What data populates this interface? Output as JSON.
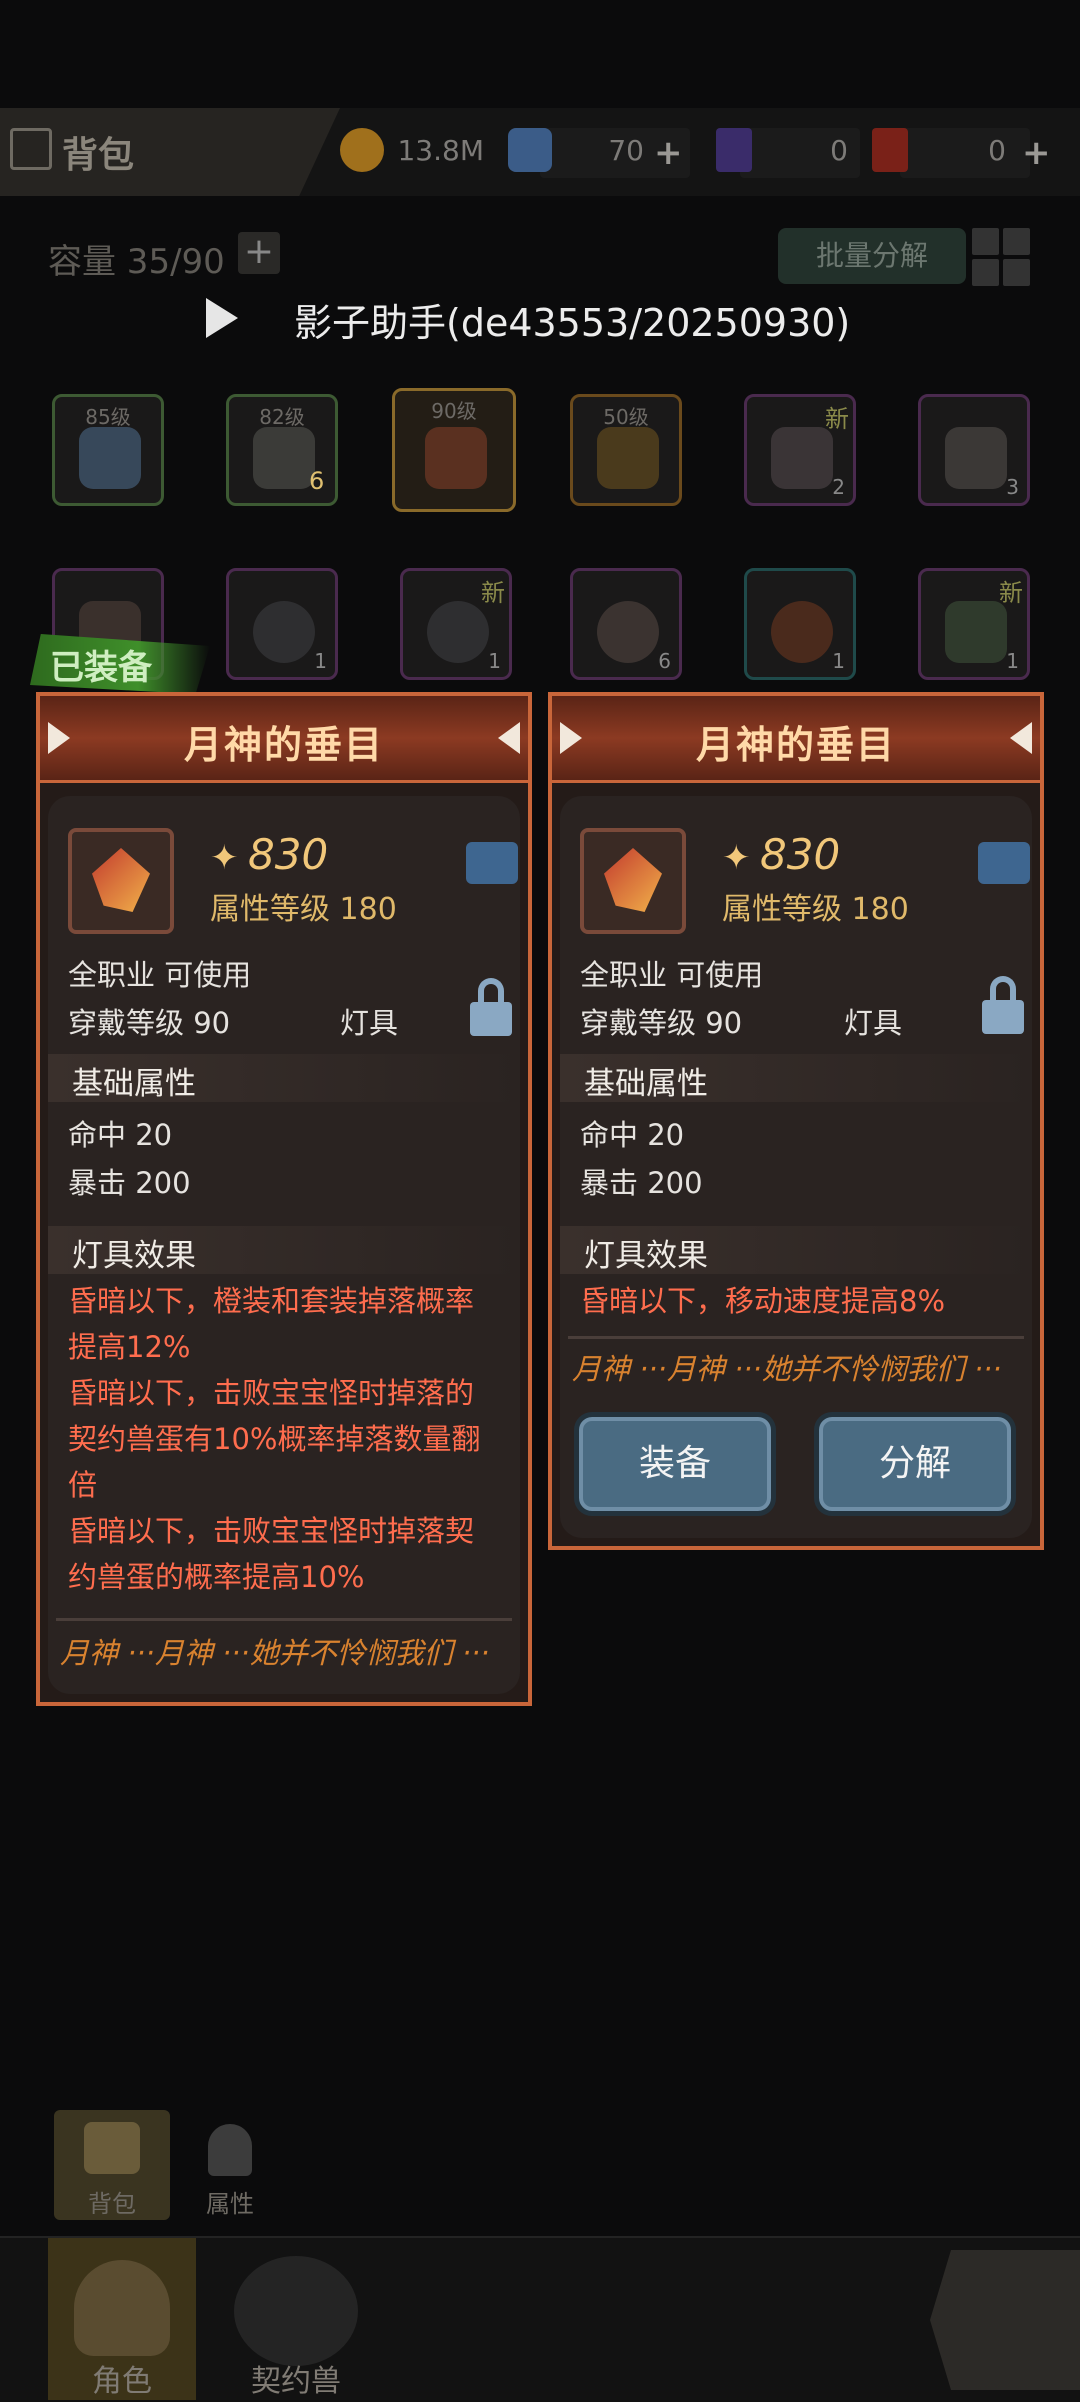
{
  "header": {
    "title": "背包",
    "gold": "13.8M",
    "crystal": "70",
    "ticket_purple": "0",
    "ticket_red": "0"
  },
  "inventory": {
    "capacity": "容量 35/90",
    "batch_decompose": "批量分解",
    "row1": [
      {
        "level": "85级",
        "count": "",
        "badge": ""
      },
      {
        "level": "82级",
        "count": "6",
        "badge": ""
      },
      {
        "level": "90级",
        "count": "",
        "badge": ""
      },
      {
        "level": "50级",
        "count": "",
        "badge": ""
      },
      {
        "level": "",
        "count": "2",
        "badge": "新"
      },
      {
        "level": "",
        "count": "3",
        "badge": ""
      }
    ],
    "row2": [
      {
        "level": "",
        "count": "",
        "badge": ""
      },
      {
        "level": "",
        "count": "1",
        "badge": ""
      },
      {
        "level": "",
        "count": "1",
        "badge": "新"
      },
      {
        "level": "",
        "count": "6",
        "badge": ""
      },
      {
        "level": "",
        "count": "1",
        "badge": ""
      },
      {
        "level": "",
        "count": "1",
        "badge": "新"
      }
    ]
  },
  "watermark": "影子助手(de43553/20250930)",
  "equipped_label": "已装备",
  "left_panel": {
    "title": "月神的垂目",
    "score": "830",
    "attr_level": "属性等级 180",
    "job": "全职业 可使用",
    "wear_level": "穿戴等级 90",
    "type": "灯具",
    "basic_title": "基础属性",
    "stats": [
      "命中  20",
      "暴击  200"
    ],
    "effect_title": "灯具效果",
    "effects": [
      "昏暗以下，橙装和套装掉落概率",
      "提高12%",
      "昏暗以下，击败宝宝怪时掉落的",
      "契约兽蛋有10%概率掉落数量翻",
      "倍",
      "昏暗以下，击败宝宝怪时掉落契",
      "约兽蛋的概率提高10%"
    ],
    "flavor": "月神 ···月神 ···她并不怜悯我们 ···"
  },
  "right_panel": {
    "title": "月神的垂目",
    "score": "830",
    "attr_level": "属性等级 180",
    "job": "全职业 可使用",
    "wear_level": "穿戴等级 90",
    "type": "灯具",
    "basic_title": "基础属性",
    "stats": [
      "命中  20",
      "暴击  200"
    ],
    "effect_title": "灯具效果",
    "effects": [
      "昏暗以下，移动速度提高8%"
    ],
    "flavor": "月神 ···月神 ···她并不怜悯我们 ···",
    "equip_button": "装备",
    "decompose_button": "分解"
  },
  "side_tabs": {
    "bag": "背包",
    "attributes": "属性"
  },
  "bottom_tabs": {
    "character": "角色",
    "pet": "契约兽"
  }
}
